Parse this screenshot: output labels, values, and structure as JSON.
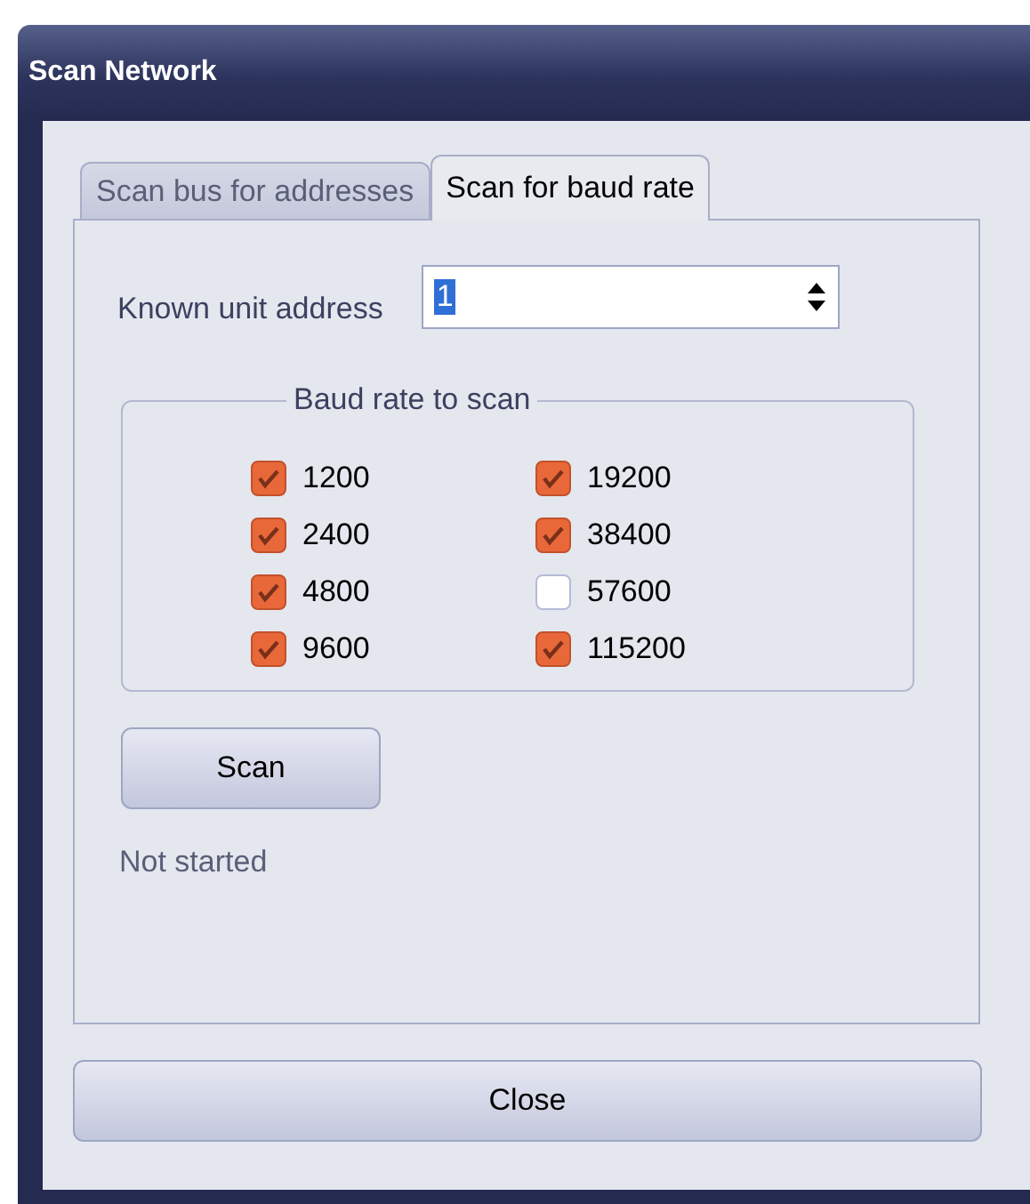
{
  "window": {
    "title": "Scan Network"
  },
  "tabs": [
    {
      "label": "Scan bus for addresses",
      "selected": false
    },
    {
      "label": "Scan for baud rate",
      "selected": true
    }
  ],
  "address": {
    "label": "Known unit address",
    "value": "1"
  },
  "baud_group": {
    "title": "Baud rate to scan",
    "options": [
      {
        "label": "1200",
        "checked": true
      },
      {
        "label": "2400",
        "checked": true
      },
      {
        "label": "4800",
        "checked": true
      },
      {
        "label": "9600",
        "checked": true
      },
      {
        "label": "19200",
        "checked": true
      },
      {
        "label": "38400",
        "checked": true
      },
      {
        "label": "57600",
        "checked": false
      },
      {
        "label": "115200",
        "checked": true
      }
    ]
  },
  "scan_button": "Scan",
  "status": "Not started",
  "close_button": "Close"
}
